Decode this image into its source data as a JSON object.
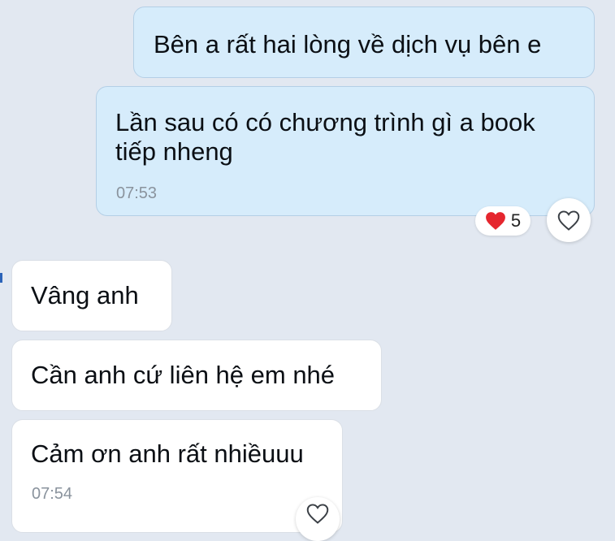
{
  "messages": [
    {
      "text": "Bên a rất hai lòng về dịch vụ bên e"
    },
    {
      "text": "Lần sau có có chương trình gì a book tiếp nheng",
      "time": "07:53"
    },
    {
      "text": "Vâng anh"
    },
    {
      "text": "Cần anh cứ liên hệ em nhé"
    },
    {
      "text": "Cảm ơn anh rất nhiềuuu",
      "time": "07:54"
    }
  ],
  "reaction": {
    "count": "5",
    "icon": "heart-icon",
    "color": "#e5262e"
  },
  "like_icon": "heart-outline-icon"
}
